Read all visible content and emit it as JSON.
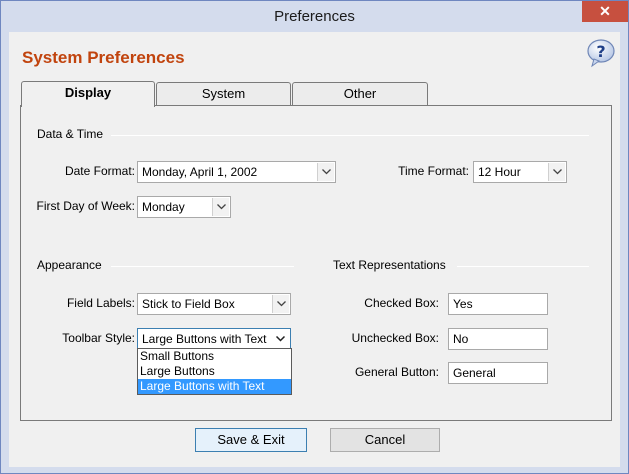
{
  "window": {
    "title": "Preferences",
    "close_glyph": "✕"
  },
  "heading": "System Preferences",
  "help_icon": "help-question-icon",
  "tabs": [
    {
      "label": "Display",
      "active": true
    },
    {
      "label": "System",
      "active": false
    },
    {
      "label": "Other",
      "active": false
    }
  ],
  "sections": {
    "date_time": "Data & Time",
    "appearance": "Appearance",
    "text_representations": "Text Representations"
  },
  "fields": {
    "date_format": {
      "label": "Date Format:",
      "value": "Monday, April 1, 2002"
    },
    "time_format": {
      "label": "Time Format:",
      "value": "12 Hour"
    },
    "first_day": {
      "label": "First Day of Week:",
      "value": "Monday"
    },
    "field_labels": {
      "label": "Field Labels:",
      "value": "Stick to Field Box"
    },
    "toolbar_style": {
      "label": "Toolbar Style:",
      "value": "Large Buttons with Text",
      "options": [
        "Small Buttons",
        "Large Buttons",
        "Large Buttons with Text"
      ],
      "selected_index": 2
    },
    "checked_box": {
      "label": "Checked Box:",
      "value": "Yes"
    },
    "unchecked_box": {
      "label": "Unchecked Box:",
      "value": "No"
    },
    "general_button": {
      "label": "General Button:",
      "value": "General"
    }
  },
  "buttons": {
    "save": "Save & Exit",
    "cancel": "Cancel"
  },
  "colors": {
    "heading": "#c1440e",
    "selection": "#3399ff",
    "close": "#c7503f"
  }
}
